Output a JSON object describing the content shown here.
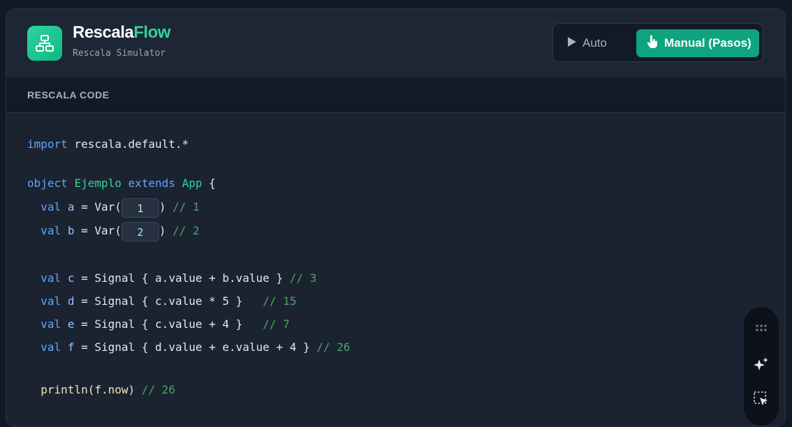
{
  "header": {
    "brand_main": "Rescala",
    "brand_accent": "Flow",
    "subtitle": "Rescala Simulator"
  },
  "modes": {
    "auto_label": "Auto",
    "manual_label": "Manual (Pasos)",
    "selected": "manual"
  },
  "section": {
    "title": "RESCALA CODE"
  },
  "code": {
    "import_kw": "import",
    "import_path": " rescala.default.*",
    "object_kw": "object",
    "object_name": "Ejemplo",
    "extends_kw": "extends",
    "app_name": "App",
    "val_kw": "val",
    "var_a": {
      "name": "a",
      "value": "1",
      "comment": "// 1"
    },
    "var_b": {
      "name": "b",
      "value": "2",
      "comment": "// 2"
    },
    "signal_c": {
      "name": "c",
      "expr": "a.value + b.value }",
      "comment": "// 3"
    },
    "signal_d": {
      "name": "d",
      "expr": "c.value * 5 }",
      "comment": "// 15"
    },
    "signal_e": {
      "name": "e",
      "expr": "c.value + 4 }",
      "comment": "// 7"
    },
    "signal_f": {
      "name": "f",
      "expr": "d.value + e.value + 4 }",
      "comment": "// 26"
    },
    "println": {
      "call": "println(f.now)",
      "comment": "// 26"
    }
  },
  "colors": {
    "accent": "#10a37f",
    "brand_accent": "#34d399",
    "keyword": "#60a5fa",
    "comment": "#4ea35e"
  },
  "icons": [
    "network-icon",
    "play-icon",
    "pointer-hand-icon",
    "grip-icon",
    "sparkle-icon",
    "selection-cursor-icon"
  ]
}
